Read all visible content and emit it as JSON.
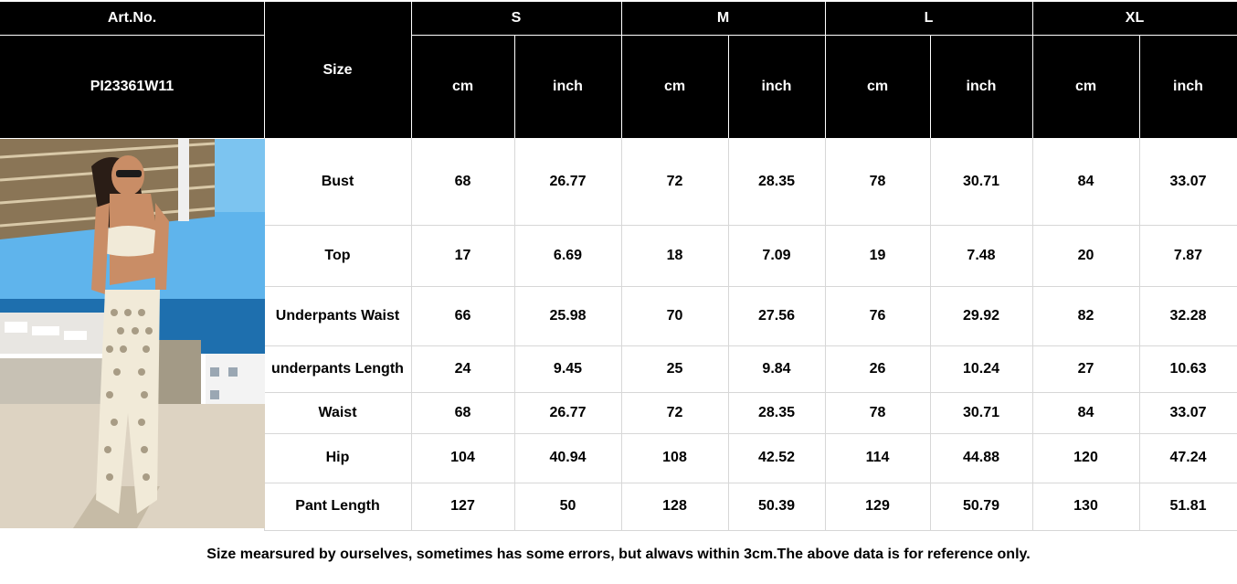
{
  "header": {
    "art_no_label": "Art.No.",
    "art_no_value": "PI23361W11",
    "size_label": "Size",
    "sizes": [
      "S",
      "M",
      "L",
      "XL"
    ],
    "units": [
      "cm",
      "inch"
    ]
  },
  "rows": [
    {
      "label": "Bust",
      "values": [
        "68",
        "26.77",
        "72",
        "28.35",
        "78",
        "30.71",
        "84",
        "33.07"
      ]
    },
    {
      "label": "Top",
      "values": [
        "17",
        "6.69",
        "18",
        "7.09",
        "19",
        "7.48",
        "20",
        "7.87"
      ]
    },
    {
      "label": "Underpants Waist",
      "values": [
        "66",
        "25.98",
        "70",
        "27.56",
        "76",
        "29.92",
        "82",
        "32.28"
      ]
    },
    {
      "label": "underpants  Length",
      "values": [
        "24",
        "9.45",
        "25",
        "9.84",
        "26",
        "10.24",
        "27",
        "10.63"
      ]
    },
    {
      "label": "Waist",
      "values": [
        "68",
        "26.77",
        "72",
        "28.35",
        "78",
        "30.71",
        "84",
        "33.07"
      ]
    },
    {
      "label": "Hip",
      "values": [
        "104",
        "40.94",
        "108",
        "42.52",
        "114",
        "44.88",
        "120",
        "47.24"
      ]
    },
    {
      "label": "Pant  Length",
      "values": [
        "127",
        "50",
        "128",
        "50.39",
        "129",
        "50.79",
        "130",
        "51.81"
      ]
    }
  ],
  "footnote": "Size mearsured by ourselves, sometimes has some errors, but alwavs within 3cm.The above data is for reference only.",
  "photo": {
    "icon": "model-photo",
    "colors": {
      "sky": "#4aa8e8",
      "sea": "#1e6fae",
      "awning": "#8a7556",
      "floor": "#ddd3c2",
      "garment": "#f1ead8"
    }
  }
}
